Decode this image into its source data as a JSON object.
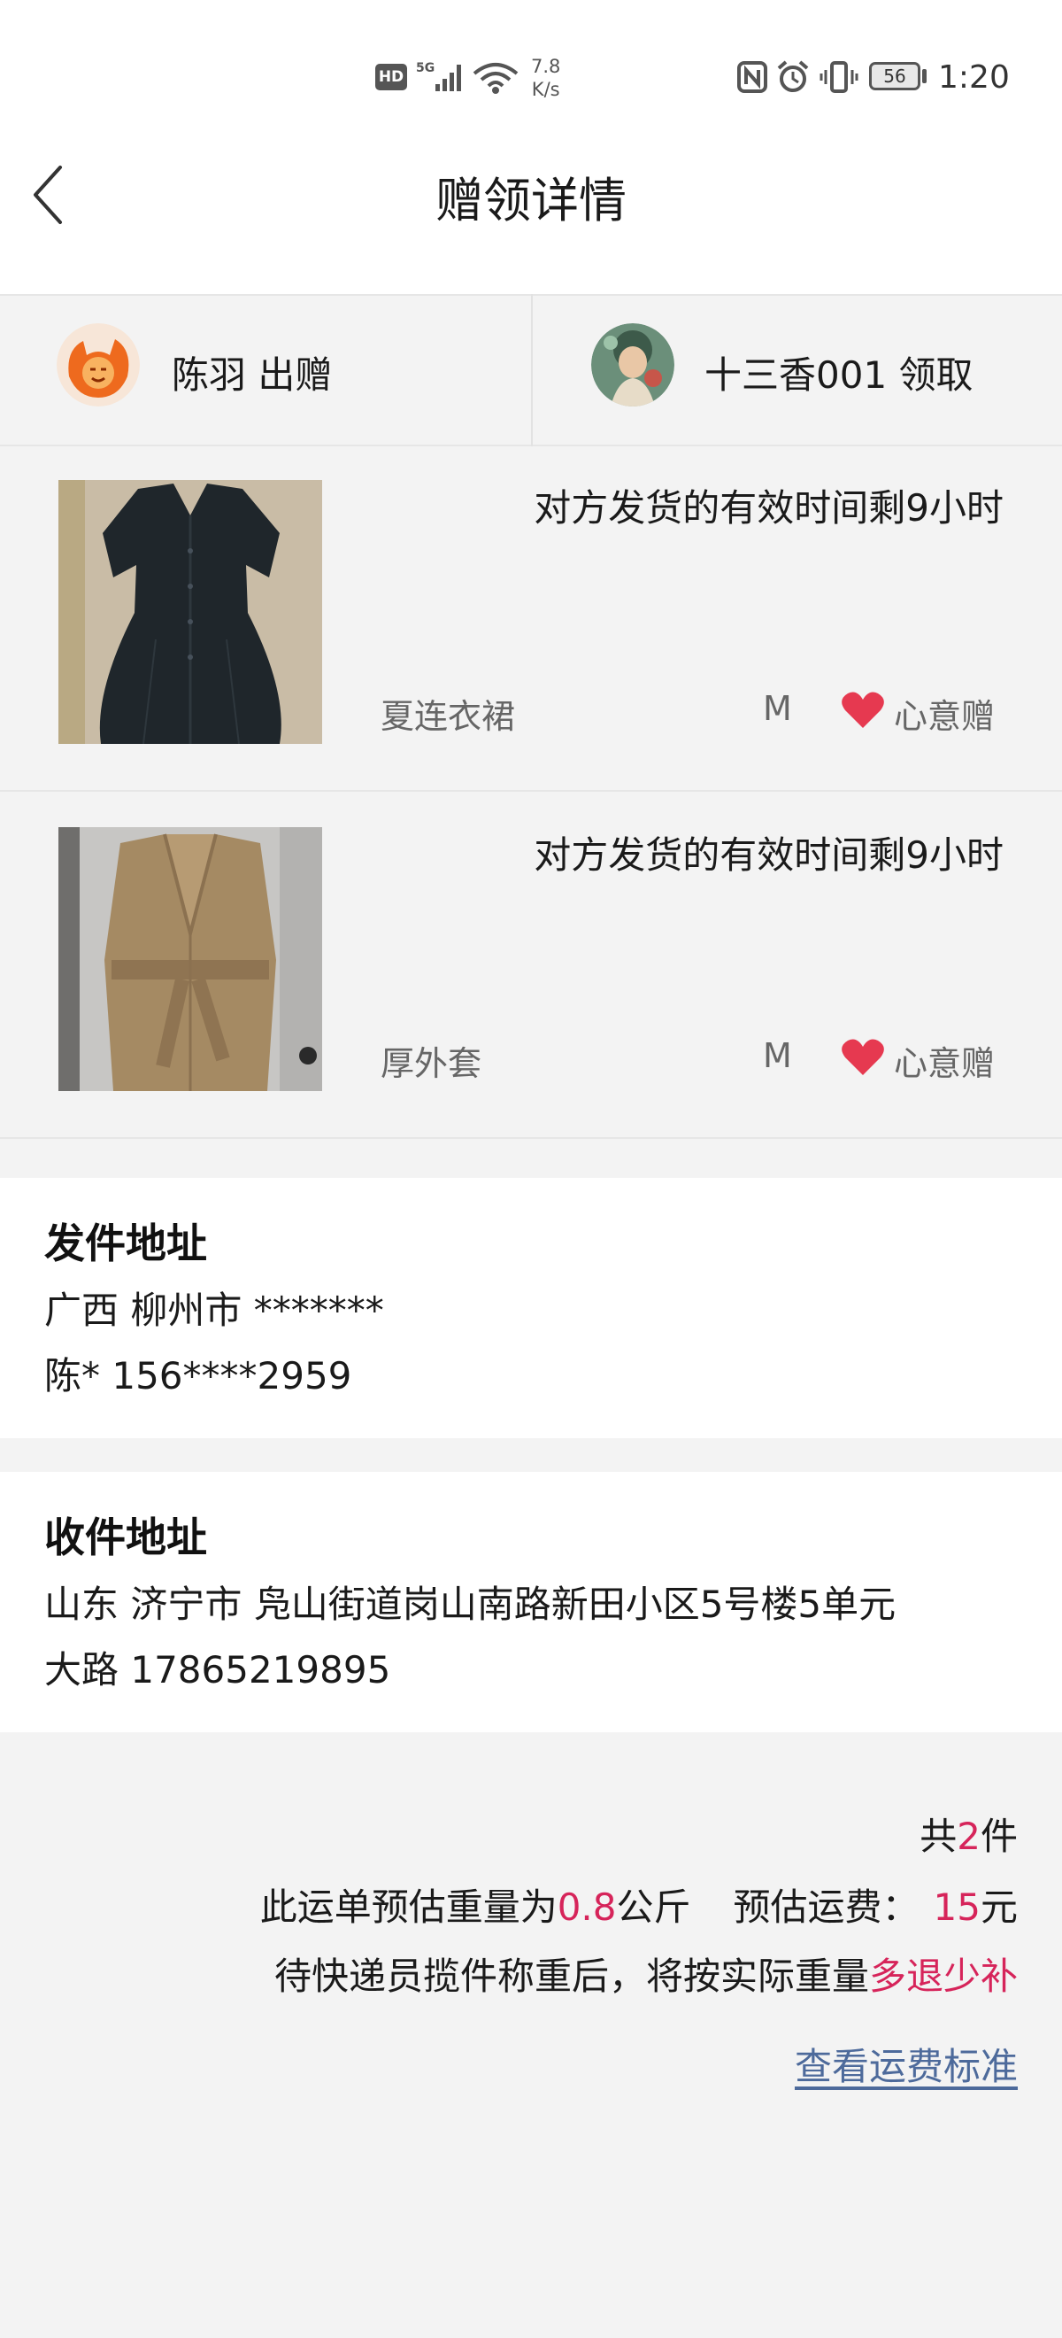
{
  "status_bar": {
    "hd": "HD",
    "network": "5G",
    "speed_value": "7.8",
    "speed_unit": "K/s",
    "battery": "56",
    "time": "1:20"
  },
  "header": {
    "title": "赠领详情"
  },
  "participants": {
    "giver_name": "陈羽",
    "giver_action": "出赠",
    "receiver_name": "十三香001",
    "receiver_action": "领取"
  },
  "items": [
    {
      "deadline": "对方发货的有效时间剩9小时",
      "name": "夏连衣裙",
      "size": "M",
      "gift_type": "心意赠"
    },
    {
      "deadline": "对方发货的有效时间剩9小时",
      "name": "厚外套",
      "size": "M",
      "gift_type": "心意赠"
    }
  ],
  "sender_address": {
    "title": "发件地址",
    "line1": "广西 柳州市 *******",
    "line2": "陈* 156****2959"
  },
  "receiver_address": {
    "title": "收件地址",
    "line1": "山东 济宁市 凫山街道岗山南路新田小区5号楼5单元",
    "line2": "大路 17865219895"
  },
  "summary": {
    "count_prefix": "共",
    "count": "2",
    "count_suffix": "件",
    "weight_prefix": "此运单预估重量为",
    "weight": "0.8",
    "weight_unit": "公斤",
    "fee_label": "预估运费：",
    "fee": "15",
    "fee_unit": "元",
    "note_prefix": "待快递员揽件称重后，将按实际重量",
    "note_highlight": "多退少补",
    "fee_standard_link": "查看运费标准"
  },
  "colors": {
    "accent_red": "#d6245a",
    "heart": "#e63950",
    "link": "#4d6a9b"
  }
}
